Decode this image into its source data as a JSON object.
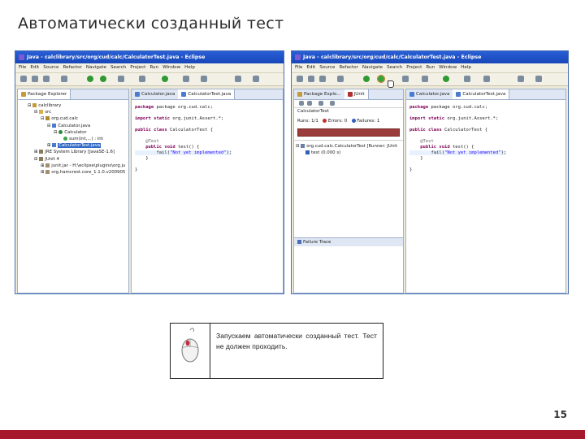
{
  "slide": {
    "title": "Автоматически созданный тест",
    "page_number": "15",
    "accent_color": "#a8182c"
  },
  "left_window": {
    "title": "Java - calclibrary/src/org/cud/calc/CalculatorTest.java - Eclipse",
    "menu": [
      "File",
      "Edit",
      "Source",
      "Refactor",
      "Navigate",
      "Search",
      "Project",
      "Run",
      "Window",
      "Help"
    ],
    "explorer_tab": "Package Explorer",
    "tree": [
      {
        "label": "calclibrary"
      },
      {
        "label": "src"
      },
      {
        "label": "org.cud.calc"
      },
      {
        "label": "Calculator.java"
      },
      {
        "label": "Calculator"
      },
      {
        "label": "sum(int,...) : int"
      },
      {
        "label": "CalculatorTest.java"
      },
      {
        "label": "JRE System Library [JavaSE-1.6]"
      },
      {
        "label": "JUnit 4"
      },
      {
        "label": "junit.jar - H:\\eclipse\\plugins\\org.ju"
      },
      {
        "label": "org.hamcrest.core_1.1.0.v200905"
      }
    ],
    "editor_tabs": [
      "Calculator.java",
      "CalculatorTest.java"
    ]
  },
  "right_window": {
    "title": "Java - calclibrary/src/org/cud/calc/CalculatorTest.java - Eclipse",
    "menu": [
      "File",
      "Edit",
      "Source",
      "Refactor",
      "Navigate",
      "Search",
      "Project",
      "Run",
      "Window",
      "Help"
    ],
    "view_tabs": [
      "Package Explo...",
      "JUnit"
    ],
    "junit_header": "CalculatorTest",
    "runs_label": "Runs:",
    "runs_value": "1/1",
    "errors_label": "Errors:",
    "errors_value": "0",
    "failures_label": "Failures:",
    "failures_value": "1",
    "result_tree": [
      {
        "label": "org.cud.calc.CalculatorTest [Runner: JUnit"
      },
      {
        "label": "test (0.000 s)"
      }
    ],
    "failure_trace_label": "Failure Trace",
    "editor_tabs": [
      "Calculator.java",
      "CalculatorTest.java"
    ]
  },
  "code": {
    "line1": "package org.cud.calc;",
    "line2_kw": "import static",
    "line2_rest": " org.junit.Assert.*;",
    "line3_kw": "public class",
    "line3_rest": " CalculatorTest {",
    "line4": "@Test",
    "line5_kw": "public void",
    "line5_rest": " test() {",
    "line6_fn": "fail(",
    "line6_str": "\"Not yet implemented\"",
    "line6_end": ");",
    "line7": "}",
    "line8": "}"
  },
  "info": {
    "text": "Запускаем автоматически созданный тест. Тест не должен проходить.",
    "icon": "mouse-icon"
  }
}
